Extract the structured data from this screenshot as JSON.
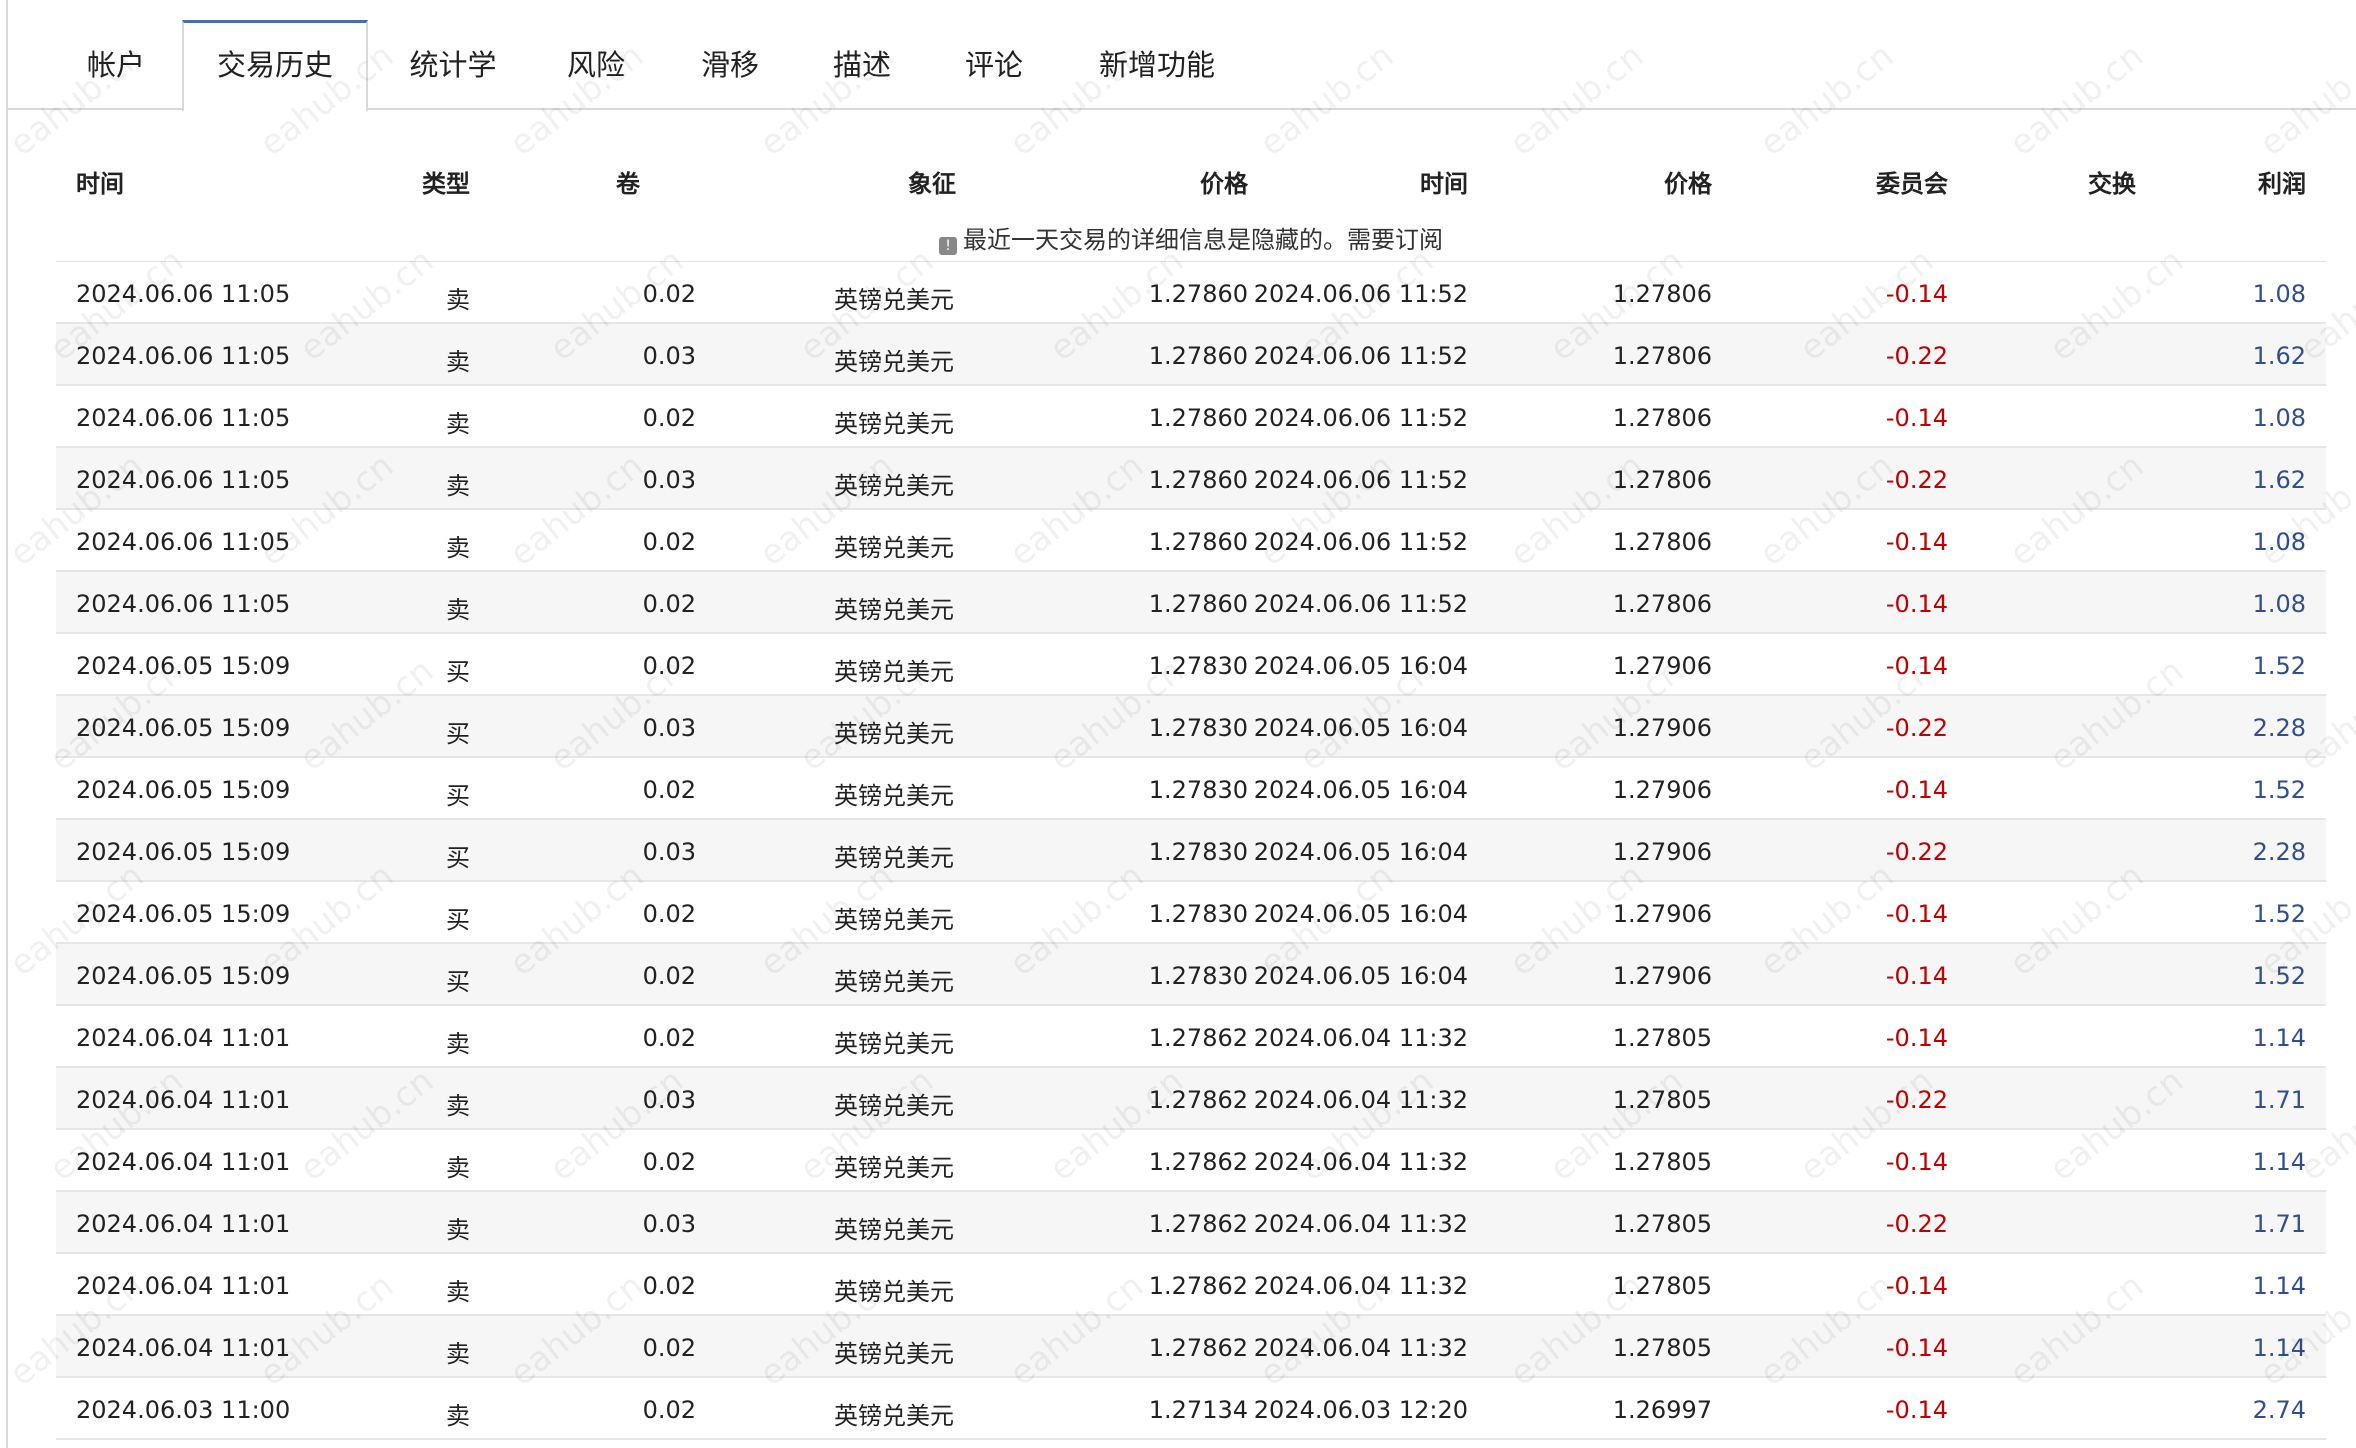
{
  "tabs": [
    {
      "label": "帐户",
      "active": false
    },
    {
      "label": "交易历史",
      "active": true
    },
    {
      "label": "统计学",
      "active": false
    },
    {
      "label": "风险",
      "active": false
    },
    {
      "label": "滑移",
      "active": false
    },
    {
      "label": "描述",
      "active": false
    },
    {
      "label": "评论",
      "active": false
    },
    {
      "label": "新增功能",
      "active": false
    }
  ],
  "table": {
    "headers": {
      "time": "时间",
      "type": "类型",
      "volume": "卷",
      "symbol": "象征",
      "price": "价格",
      "close_time": "时间",
      "close_price": "价格",
      "commission": "委员会",
      "swap": "交换",
      "profit": "利润"
    },
    "notice": "最近一天交易的详细信息是隐藏的。需要订阅",
    "rows": [
      {
        "time": "2024.06.06 11:05",
        "type": "卖",
        "volume": "0.02",
        "symbol": "英镑兑美元",
        "price": "1.27860",
        "close_time": "2024.06.06 11:52",
        "close_price": "1.27806",
        "commission": "-0.14",
        "swap": "",
        "profit": "1.08"
      },
      {
        "time": "2024.06.06 11:05",
        "type": "卖",
        "volume": "0.03",
        "symbol": "英镑兑美元",
        "price": "1.27860",
        "close_time": "2024.06.06 11:52",
        "close_price": "1.27806",
        "commission": "-0.22",
        "swap": "",
        "profit": "1.62"
      },
      {
        "time": "2024.06.06 11:05",
        "type": "卖",
        "volume": "0.02",
        "symbol": "英镑兑美元",
        "price": "1.27860",
        "close_time": "2024.06.06 11:52",
        "close_price": "1.27806",
        "commission": "-0.14",
        "swap": "",
        "profit": "1.08"
      },
      {
        "time": "2024.06.06 11:05",
        "type": "卖",
        "volume": "0.03",
        "symbol": "英镑兑美元",
        "price": "1.27860",
        "close_time": "2024.06.06 11:52",
        "close_price": "1.27806",
        "commission": "-0.22",
        "swap": "",
        "profit": "1.62"
      },
      {
        "time": "2024.06.06 11:05",
        "type": "卖",
        "volume": "0.02",
        "symbol": "英镑兑美元",
        "price": "1.27860",
        "close_time": "2024.06.06 11:52",
        "close_price": "1.27806",
        "commission": "-0.14",
        "swap": "",
        "profit": "1.08"
      },
      {
        "time": "2024.06.06 11:05",
        "type": "卖",
        "volume": "0.02",
        "symbol": "英镑兑美元",
        "price": "1.27860",
        "close_time": "2024.06.06 11:52",
        "close_price": "1.27806",
        "commission": "-0.14",
        "swap": "",
        "profit": "1.08"
      },
      {
        "time": "2024.06.05 15:09",
        "type": "买",
        "volume": "0.02",
        "symbol": "英镑兑美元",
        "price": "1.27830",
        "close_time": "2024.06.05 16:04",
        "close_price": "1.27906",
        "commission": "-0.14",
        "swap": "",
        "profit": "1.52"
      },
      {
        "time": "2024.06.05 15:09",
        "type": "买",
        "volume": "0.03",
        "symbol": "英镑兑美元",
        "price": "1.27830",
        "close_time": "2024.06.05 16:04",
        "close_price": "1.27906",
        "commission": "-0.22",
        "swap": "",
        "profit": "2.28"
      },
      {
        "time": "2024.06.05 15:09",
        "type": "买",
        "volume": "0.02",
        "symbol": "英镑兑美元",
        "price": "1.27830",
        "close_time": "2024.06.05 16:04",
        "close_price": "1.27906",
        "commission": "-0.14",
        "swap": "",
        "profit": "1.52"
      },
      {
        "time": "2024.06.05 15:09",
        "type": "买",
        "volume": "0.03",
        "symbol": "英镑兑美元",
        "price": "1.27830",
        "close_time": "2024.06.05 16:04",
        "close_price": "1.27906",
        "commission": "-0.22",
        "swap": "",
        "profit": "2.28"
      },
      {
        "time": "2024.06.05 15:09",
        "type": "买",
        "volume": "0.02",
        "symbol": "英镑兑美元",
        "price": "1.27830",
        "close_time": "2024.06.05 16:04",
        "close_price": "1.27906",
        "commission": "-0.14",
        "swap": "",
        "profit": "1.52"
      },
      {
        "time": "2024.06.05 15:09",
        "type": "买",
        "volume": "0.02",
        "symbol": "英镑兑美元",
        "price": "1.27830",
        "close_time": "2024.06.05 16:04",
        "close_price": "1.27906",
        "commission": "-0.14",
        "swap": "",
        "profit": "1.52"
      },
      {
        "time": "2024.06.04 11:01",
        "type": "卖",
        "volume": "0.02",
        "symbol": "英镑兑美元",
        "price": "1.27862",
        "close_time": "2024.06.04 11:32",
        "close_price": "1.27805",
        "commission": "-0.14",
        "swap": "",
        "profit": "1.14"
      },
      {
        "time": "2024.06.04 11:01",
        "type": "卖",
        "volume": "0.03",
        "symbol": "英镑兑美元",
        "price": "1.27862",
        "close_time": "2024.06.04 11:32",
        "close_price": "1.27805",
        "commission": "-0.22",
        "swap": "",
        "profit": "1.71"
      },
      {
        "time": "2024.06.04 11:01",
        "type": "卖",
        "volume": "0.02",
        "symbol": "英镑兑美元",
        "price": "1.27862",
        "close_time": "2024.06.04 11:32",
        "close_price": "1.27805",
        "commission": "-0.14",
        "swap": "",
        "profit": "1.14"
      },
      {
        "time": "2024.06.04 11:01",
        "type": "卖",
        "volume": "0.03",
        "symbol": "英镑兑美元",
        "price": "1.27862",
        "close_time": "2024.06.04 11:32",
        "close_price": "1.27805",
        "commission": "-0.22",
        "swap": "",
        "profit": "1.71"
      },
      {
        "time": "2024.06.04 11:01",
        "type": "卖",
        "volume": "0.02",
        "symbol": "英镑兑美元",
        "price": "1.27862",
        "close_time": "2024.06.04 11:32",
        "close_price": "1.27805",
        "commission": "-0.14",
        "swap": "",
        "profit": "1.14"
      },
      {
        "time": "2024.06.04 11:01",
        "type": "卖",
        "volume": "0.02",
        "symbol": "英镑兑美元",
        "price": "1.27862",
        "close_time": "2024.06.04 11:32",
        "close_price": "1.27805",
        "commission": "-0.14",
        "swap": "",
        "profit": "1.14"
      },
      {
        "time": "2024.06.03 11:00",
        "type": "卖",
        "volume": "0.02",
        "symbol": "英镑兑美元",
        "price": "1.27134",
        "close_time": "2024.06.03 12:20",
        "close_price": "1.26997",
        "commission": "-0.14",
        "swap": "",
        "profit": "2.74"
      }
    ]
  },
  "watermark": "eahub.cn",
  "colors": {
    "negative": "#c00000",
    "positive": "#2f4f8f",
    "tab_accent": "#4a6ea9"
  }
}
